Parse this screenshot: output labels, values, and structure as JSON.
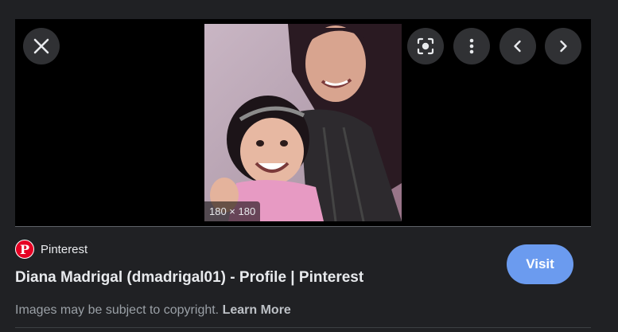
{
  "viewer": {
    "image_dimensions": "180 × 180",
    "buttons": {
      "close": "close-icon",
      "lens": "google-lens-icon",
      "more": "more-vert-icon",
      "previous": "chevron-left-icon",
      "next": "chevron-right-icon"
    }
  },
  "result": {
    "source_name": "Pinterest",
    "source_logo_letter": "P",
    "title": "Diana Madrigal (dmadrigal01) - Profile | Pinterest",
    "visit_label": "Visit",
    "copyright_text": "Images may be subject to copyright. ",
    "learn_more_label": "Learn More"
  },
  "colors": {
    "background": "#202124",
    "viewer": "#000000",
    "button": "#303134",
    "visit": "#6b9bef",
    "pinterest_red": "#e60023"
  }
}
